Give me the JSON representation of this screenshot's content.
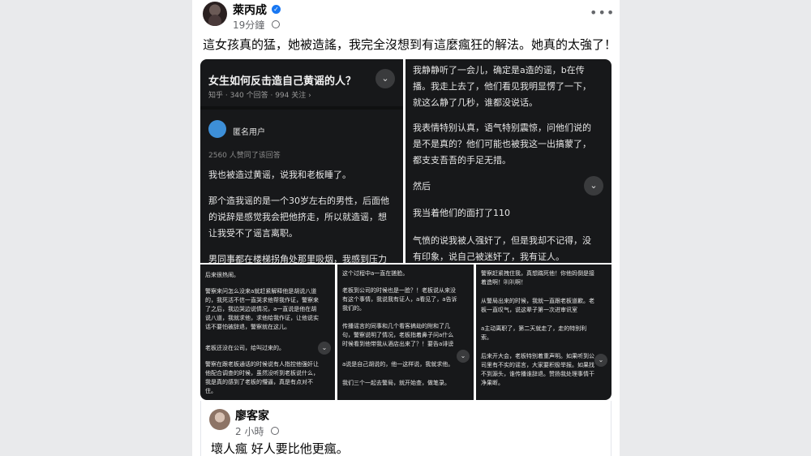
{
  "post": {
    "author": "萊丙成",
    "time": "19分鐘",
    "caption": "這女孩真的猛，她被造謠，我完全沒想到有這麼瘋狂的解法。她真的太強了！"
  },
  "img1": {
    "title": "女生如何反击造自己黄谣的人？",
    "meta": "知乎 · 340 个回答 · 994 关注 ›",
    "user": "匿名用户",
    "likes": "2560 人赞同了该回答",
    "lines": [
      "我也被造过黄谣，说我和老板睡了。",
      "那个造我谣的是一个30岁左右的男性，后面他",
      "的说辞是感觉我会把他挤走，所以就造谣，想",
      "让我受不了谣言离职。",
      "男同事都在楼梯拐角处那里吸烟，我感到压力"
    ]
  },
  "img2": {
    "lines": [
      "我静静听了一会儿，确定是a造的谣，b在传",
      "播。我走上去了，他们看见我明显愣了一下，",
      "就这么静了几秒，谁都没说话。",
      "我表情特别认真，语气特别震惊，问他们说的",
      "是不是真的？他们可能也被我这一出搞蒙了，",
      "都支支吾吾的手足无措。",
      "然后",
      "我当着他们的面打了110",
      "气愤的说我被人强奸了，但是我却不记得，没",
      "有印象，说自己被迷奸了，我有证人。"
    ]
  },
  "img3": {
    "lines": [
      "后来很热闹。",
      "警察来问怎么没来a就赶紧解释他是胡说八道",
      "的，我死活不信一直哭求他帮我作证，警察来",
      "了之后，我边哭边说情况，a一直说是他在胡",
      "说八道，我就求他，求他给我作证，让他说实",
      "话不要怕被辞退，警察就在这儿。",
      "老板还没在公司，给叫过来的。",
      "警察在跟老板通话的时候说有人指控他强奸让",
      "他配合调查的时候，虽然没听到老板说什么，",
      "我是真的感到了老板的懵逼，真是有点对不",
      "住。"
    ]
  },
  "img4": {
    "lines": [
      "这个过程中a一直在搓脸。",
      "老板到公司的时候也是一脸？！老板说从来没",
      "有这个事情，我说我有证人，a看见了，a告诉",
      "我们的。",
      "传播谣言的同事和几个看客搞劫的附和了几",
      "句，警察说明了情况，老板指着鼻子问a什么",
      "时候看到他带我从酒店出来了？！要告a诽谤",
      "a说是自己胡说的，他一这样说，我就求他。",
      "我们三个一起去警局，就开始查，做笔录。"
    ]
  },
  "img5": {
    "lines": [
      "警察赶紧拽住我，真想踹死他！你他妈倒是接",
      "着造啊！叭叭啊！",
      "从警局出来的时候，我就一直跟老板道歉。老",
      "板一直叹气，说这辈子第一次进审讯室",
      "a主动离职了，第二天就走了，走的特别利",
      "索。",
      "后来开大会，老板特别着重声明。如果听到公",
      "司里有不实的谣言，大家要积极举报。如果找",
      "不到源头，谁传播谁辞退。赞扬我处理事情干",
      "净果断。"
    ]
  },
  "comment": {
    "author": "廖客家",
    "time": "2 小時",
    "text": "壞人瘋 好人要比他更瘋。"
  },
  "icons": {
    "more": "more-icon",
    "verified": "verified-badge-icon",
    "globe": "globe-icon",
    "chevron": "chevron-down-icon"
  },
  "colors": {
    "accent": "#1877f2",
    "panel": "#17181a"
  }
}
